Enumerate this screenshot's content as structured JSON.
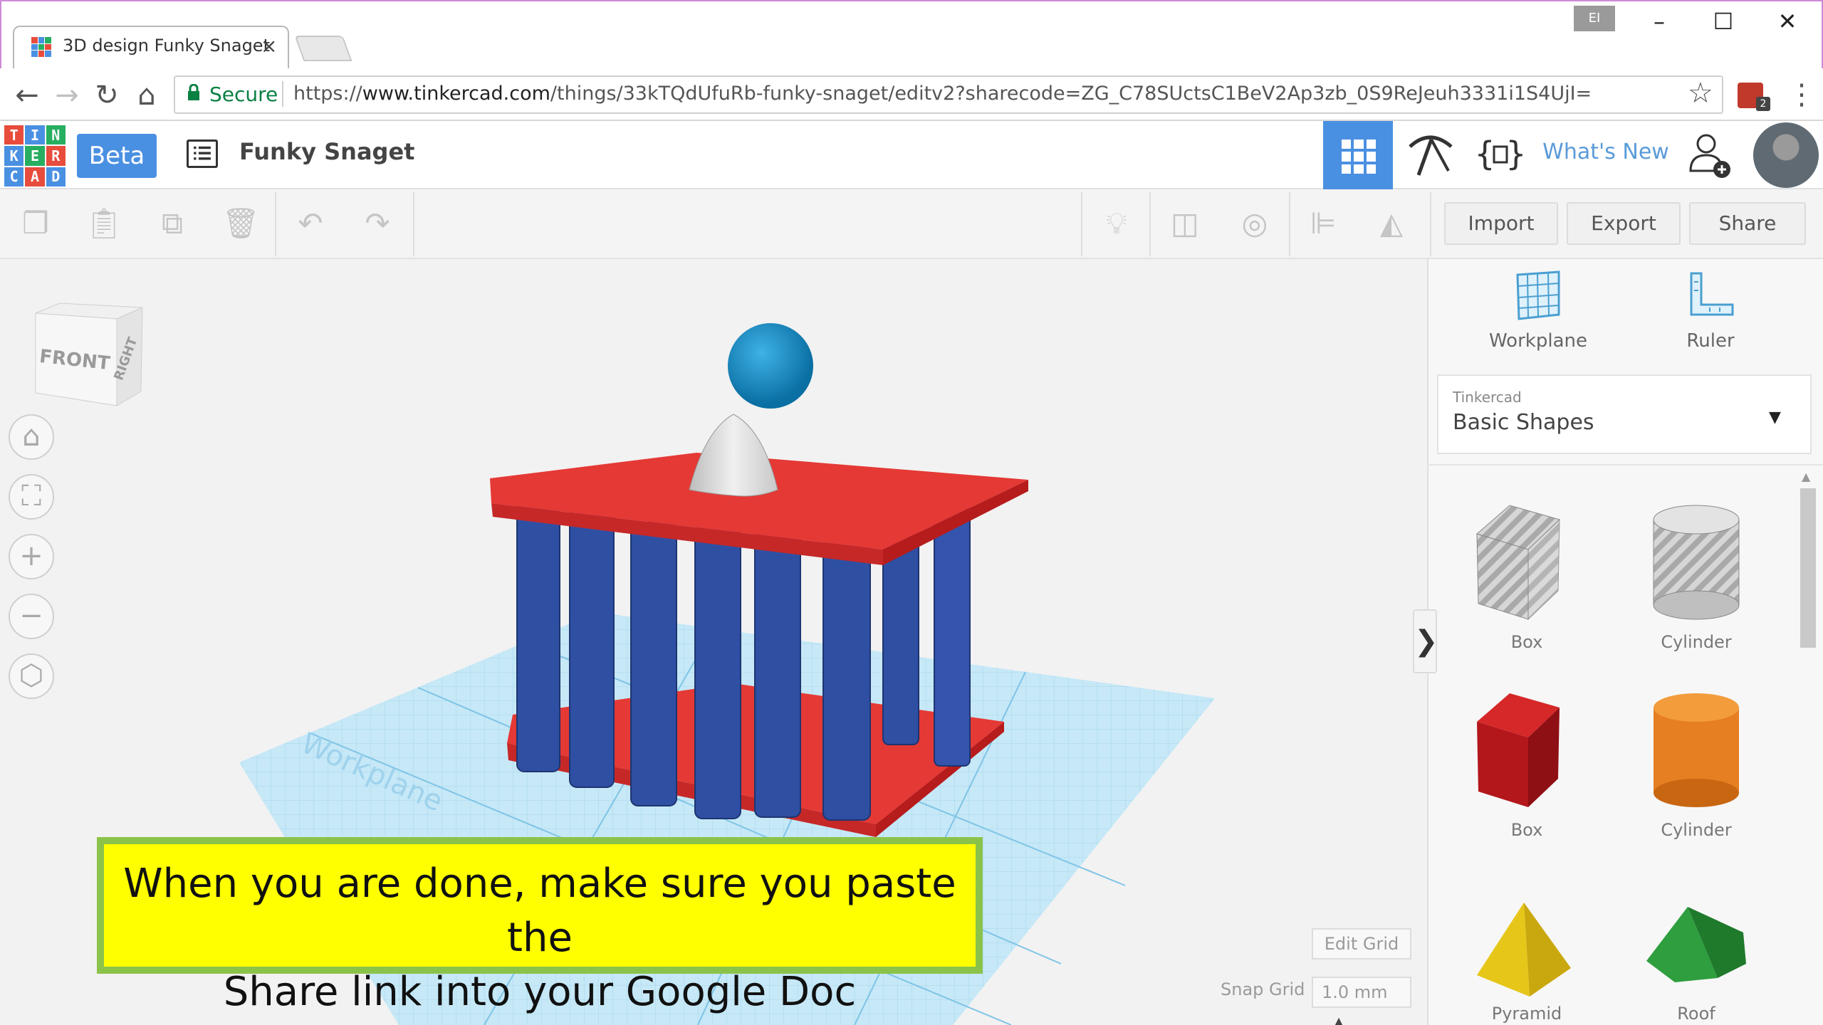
{
  "browser": {
    "tab_title": "3D design Funky Snaget",
    "tab_close": "×",
    "secure_label": "Secure",
    "url_scheme": "https://",
    "url_host": "www.tinkercad.com",
    "url_path": "/things/33kTQdUfuRb-funky-snaget/editv2?sharecode=ZG_C78SUctsC1BeV2Ap3zb_0S9ReJeuh3331i1S4UjI=",
    "extension_badge": "2",
    "window_ext_label": "EI",
    "icons": [
      "back-icon",
      "forward-icon",
      "reload-icon",
      "home-icon",
      "lock-icon",
      "star-icon",
      "menu-icon",
      "minimize-icon",
      "maximize-icon",
      "close-icon"
    ]
  },
  "header": {
    "logo_letters": [
      "T",
      "I",
      "N",
      "K",
      "E",
      "R",
      "C",
      "A",
      "D"
    ],
    "logo_colors": [
      "#e74c3c",
      "#4a90e2",
      "#27ae60",
      "#4a90e2",
      "#27ae60",
      "#e74c3c",
      "#4a90e2",
      "#e74c3c",
      "#4a90e2"
    ],
    "beta_label": "Beta",
    "design_title": "Funky Snaget",
    "whats_new": "What's New",
    "accent": "#4a90e2"
  },
  "toolbar": {
    "import_label": "Import",
    "export_label": "Export",
    "share_label": "Share",
    "icons": [
      "copy-icon",
      "paste-icon",
      "duplicate-icon",
      "delete-icon",
      "undo-icon",
      "redo-icon",
      "light-bulb-icon",
      "group-icon",
      "hole-icon",
      "align-icon",
      "mirror-icon"
    ]
  },
  "canvas": {
    "view_cube_front": "FRONT",
    "view_cube_right": "RIGHT",
    "workplane_watermark": "Workplane",
    "edit_grid_label": "Edit Grid",
    "snap_grid_label": "Snap Grid",
    "snap_grid_value": "1.0 mm",
    "snap_grid_caret": "▴",
    "side_controls": [
      "home-view-icon",
      "fit-view-icon",
      "zoom-in-icon",
      "zoom-out-icon",
      "orthographic-icon"
    ]
  },
  "callout": {
    "line1": "When you are done, make sure you paste the",
    "line2": "Share link into your Google Doc",
    "bg_color": "#ffff00",
    "border_color": "#8bc34a"
  },
  "panel": {
    "workplane_label": "Workplane",
    "ruler_label": "Ruler",
    "library_provider": "Tinkercad",
    "library_name": "Basic Shapes",
    "library_caret": "▼",
    "collapse_glyph": "❯",
    "shapes": [
      {
        "label": "Box",
        "kind": "box-hole"
      },
      {
        "label": "Cylinder",
        "kind": "cylinder-hole"
      },
      {
        "label": "Box",
        "kind": "box"
      },
      {
        "label": "Cylinder",
        "kind": "cylinder"
      },
      {
        "label": "Pyramid",
        "kind": "pyramid"
      },
      {
        "label": "Roof",
        "kind": "roof"
      }
    ]
  }
}
